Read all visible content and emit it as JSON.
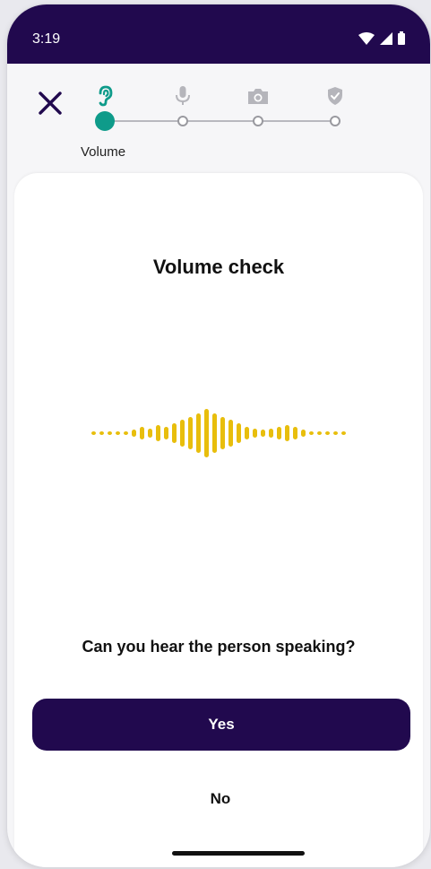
{
  "status_bar": {
    "time": "3:19",
    "icons": [
      "wifi-icon",
      "cellular-signal-icon",
      "battery-icon"
    ]
  },
  "progress": {
    "steps": [
      {
        "icon": "ear-icon",
        "label": "Volume",
        "active": true
      },
      {
        "icon": "microphone-icon",
        "label": "",
        "active": false
      },
      {
        "icon": "camera-icon",
        "label": "",
        "active": false
      },
      {
        "icon": "shield-check-icon",
        "label": "",
        "active": false
      }
    ],
    "active_label": "Volume"
  },
  "main": {
    "title": "Volume check",
    "question": "Can you hear the person speaking?",
    "yes_label": "Yes",
    "no_label": "No"
  },
  "colors": {
    "brand": "#21094e",
    "accent": "#0e9b8a",
    "wave": "#e8be0c"
  }
}
